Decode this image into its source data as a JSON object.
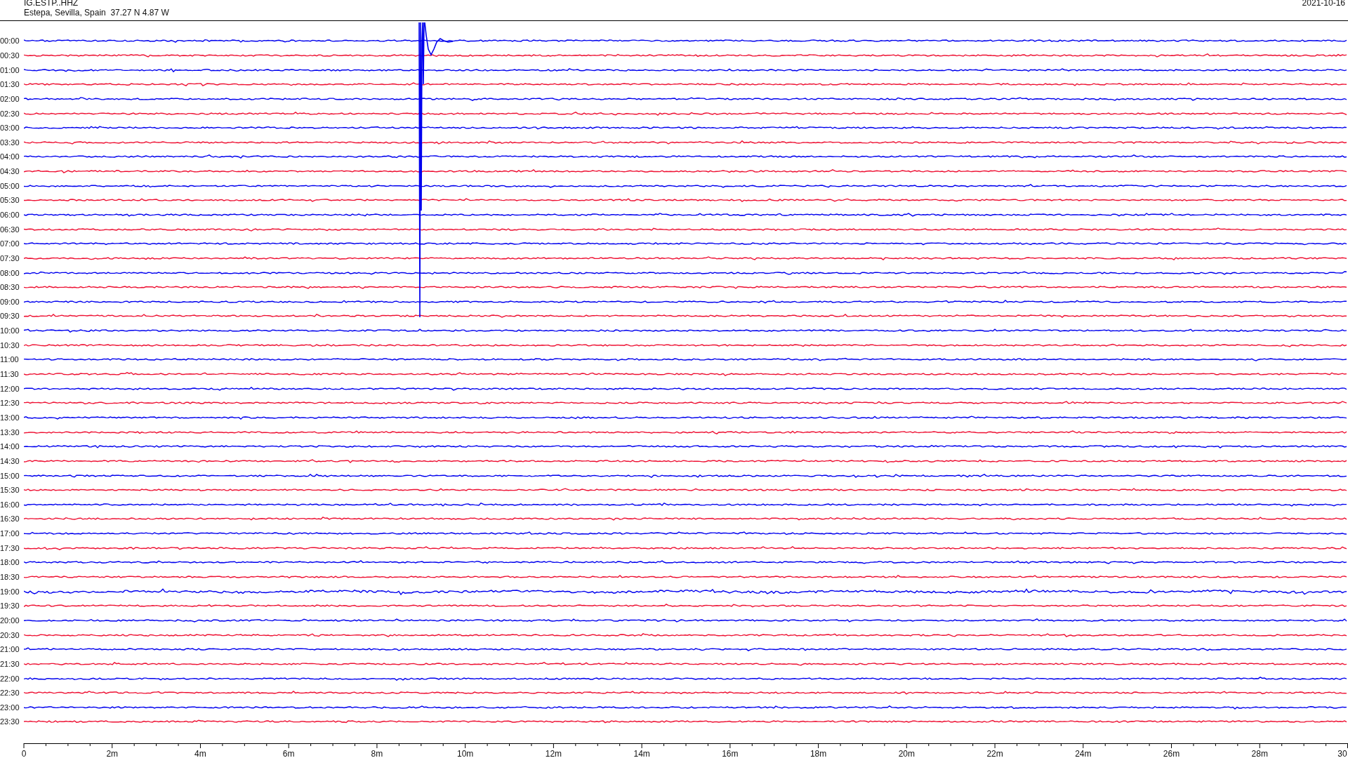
{
  "station": {
    "code": "IG.ESTP..HHZ",
    "location": "Estepa, Sevilla, Spain  37.27 N 4.87 W",
    "date": "2021-10-16"
  },
  "rows": [
    {
      "label": "00:00",
      "color": "#0000ee"
    },
    {
      "label": "00:30",
      "color": "#ee1133"
    },
    {
      "label": "01:00",
      "color": "#0000ee"
    },
    {
      "label": "01:30",
      "color": "#ee1133"
    },
    {
      "label": "02:00",
      "color": "#0000ee"
    },
    {
      "label": "02:30",
      "color": "#ee1133"
    },
    {
      "label": "03:00",
      "color": "#0000ee"
    },
    {
      "label": "03:30",
      "color": "#ee1133"
    },
    {
      "label": "04:00",
      "color": "#0000ee"
    },
    {
      "label": "04:30",
      "color": "#ee1133"
    },
    {
      "label": "05:00",
      "color": "#0000ee"
    },
    {
      "label": "05:30",
      "color": "#ee1133"
    },
    {
      "label": "06:00",
      "color": "#0000ee"
    },
    {
      "label": "06:30",
      "color": "#ee1133"
    },
    {
      "label": "07:00",
      "color": "#0000ee"
    },
    {
      "label": "07:30",
      "color": "#ee1133"
    },
    {
      "label": "08:00",
      "color": "#0000ee"
    },
    {
      "label": "08:30",
      "color": "#ee1133"
    },
    {
      "label": "09:00",
      "color": "#0000ee"
    },
    {
      "label": "09:30",
      "color": "#ee1133"
    },
    {
      "label": "10:00",
      "color": "#0000ee"
    },
    {
      "label": "10:30",
      "color": "#ee1133"
    },
    {
      "label": "11:00",
      "color": "#0000ee"
    },
    {
      "label": "11:30",
      "color": "#ee1133"
    },
    {
      "label": "12:00",
      "color": "#0000ee"
    },
    {
      "label": "12:30",
      "color": "#ee1133"
    },
    {
      "label": "13:00",
      "color": "#0000ee"
    },
    {
      "label": "13:30",
      "color": "#ee1133"
    },
    {
      "label": "14:00",
      "color": "#0000ee"
    },
    {
      "label": "14:30",
      "color": "#ee1133"
    },
    {
      "label": "15:00",
      "color": "#0000ee"
    },
    {
      "label": "15:30",
      "color": "#ee1133"
    },
    {
      "label": "16:00",
      "color": "#0000ee"
    },
    {
      "label": "16:30",
      "color": "#ee1133"
    },
    {
      "label": "17:00",
      "color": "#0000ee"
    },
    {
      "label": "17:30",
      "color": "#ee1133"
    },
    {
      "label": "18:00",
      "color": "#0000ee"
    },
    {
      "label": "18:30",
      "color": "#ee1133"
    },
    {
      "label": "19:00",
      "color": "#0000ee"
    },
    {
      "label": "19:30",
      "color": "#ee1133"
    },
    {
      "label": "20:00",
      "color": "#0000ee"
    },
    {
      "label": "20:30",
      "color": "#ee1133"
    },
    {
      "label": "21:00",
      "color": "#0000ee"
    },
    {
      "label": "21:30",
      "color": "#ee1133"
    },
    {
      "label": "22:00",
      "color": "#0000ee"
    },
    {
      "label": "22:30",
      "color": "#ee1133"
    },
    {
      "label": "23:00",
      "color": "#0000ee"
    },
    {
      "label": "23:30",
      "color": "#ee1133"
    }
  ],
  "x_axis": {
    "ticks": [
      "0",
      "2m",
      "4m",
      "6m",
      "8m",
      "10m",
      "12m",
      "14m",
      "16m",
      "18m",
      "20m",
      "22m",
      "24m",
      "26m",
      "28m",
      "30"
    ]
  }
}
